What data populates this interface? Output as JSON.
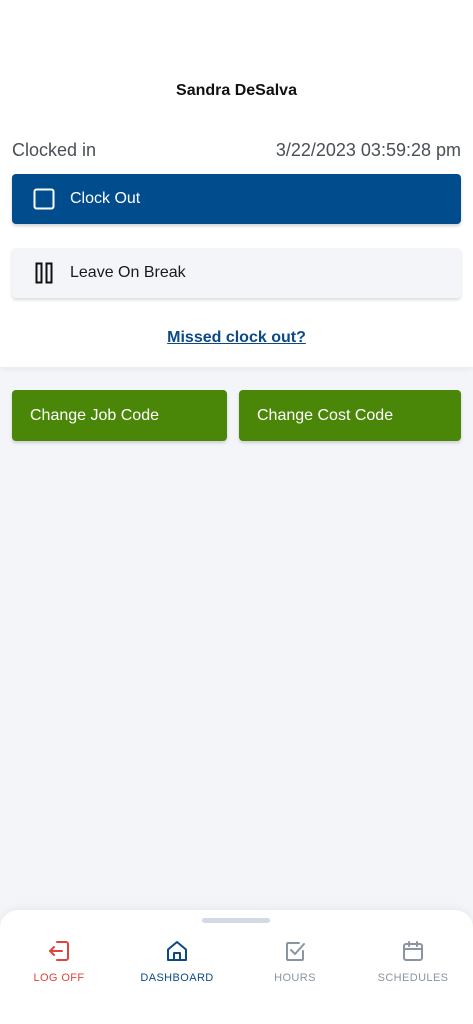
{
  "user": {
    "name": "Sandra DeSalva"
  },
  "status": {
    "label": "Clocked in",
    "timestamp": "3/22/2023 03:59:28 pm"
  },
  "actions": {
    "clock_out": "Clock Out",
    "leave_on_break": "Leave On Break",
    "missed_clock_out": "Missed clock out?",
    "change_job_code": "Change Job Code",
    "change_cost_code": "Change Cost Code"
  },
  "nav": {
    "items": [
      {
        "label": "LOG OFF",
        "icon": "log-off-icon",
        "color": "#e1443c"
      },
      {
        "label": "DASHBOARD",
        "icon": "home-icon",
        "color": "#0c4a86",
        "active": true
      },
      {
        "label": "HOURS",
        "icon": "checkbox-icon",
        "color": "#8a94a3"
      },
      {
        "label": "SCHEDULES",
        "icon": "calendar-icon",
        "color": "#8a94a3"
      }
    ]
  },
  "colors": {
    "primary_blue": "#004c8c",
    "green": "#4a8708",
    "background": "#f3f5f9",
    "logoff_red": "#e1443c"
  }
}
